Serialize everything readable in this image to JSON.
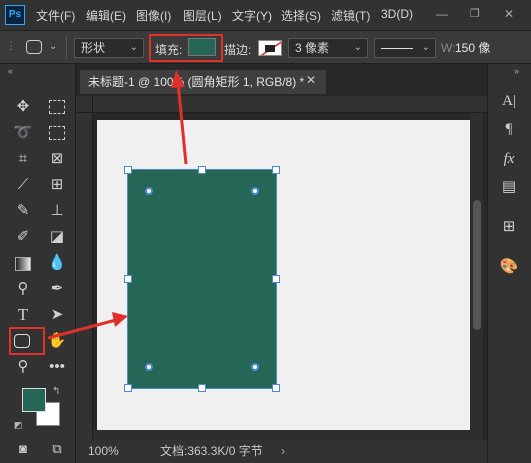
{
  "app": {
    "logo": "Ps"
  },
  "menu": {
    "items": [
      "文件(F)",
      "编辑(E)",
      "图像(I)",
      "图层(L)",
      "文字(Y)",
      "选择(S)",
      "滤镜(T)",
      "3D(D)"
    ]
  },
  "options_bar": {
    "shape_mode": "形状",
    "fill_label": "填充:",
    "fill_color": "#256657",
    "stroke_label": "描边:",
    "stroke_width": "3 像素",
    "width_label": "W:",
    "width_value": "150 像"
  },
  "document": {
    "tab_title": "未标题-1 @ 100% (圆角矩形 1, RGB/8) *",
    "shape_fill": "#256657",
    "zoom": "100%",
    "doc_info": "文档:363.3K/0 字节"
  },
  "colors": {
    "foreground": "#256657",
    "background": "#ffffff",
    "annotation": "#e0302a"
  },
  "tools": [
    "move-tool",
    "marquee-tool",
    "lasso-tool",
    "object-select-tool",
    "crop-tool",
    "frame-tool",
    "eyedropper-tool",
    "spot-heal-tool",
    "brush-tool",
    "stamp-tool",
    "history-brush-tool",
    "eraser-tool",
    "gradient-tool",
    "blur-tool",
    "dodge-tool",
    "pen-tool",
    "type-tool",
    "path-select-tool",
    "rounded-rectangle-tool",
    "hand-tool",
    "zoom-tool",
    "more-tools"
  ],
  "right_panel": [
    "character-icon",
    "paragraph-icon",
    "fx-icon",
    "properties-icon",
    "table-icon",
    "palette-icon"
  ]
}
